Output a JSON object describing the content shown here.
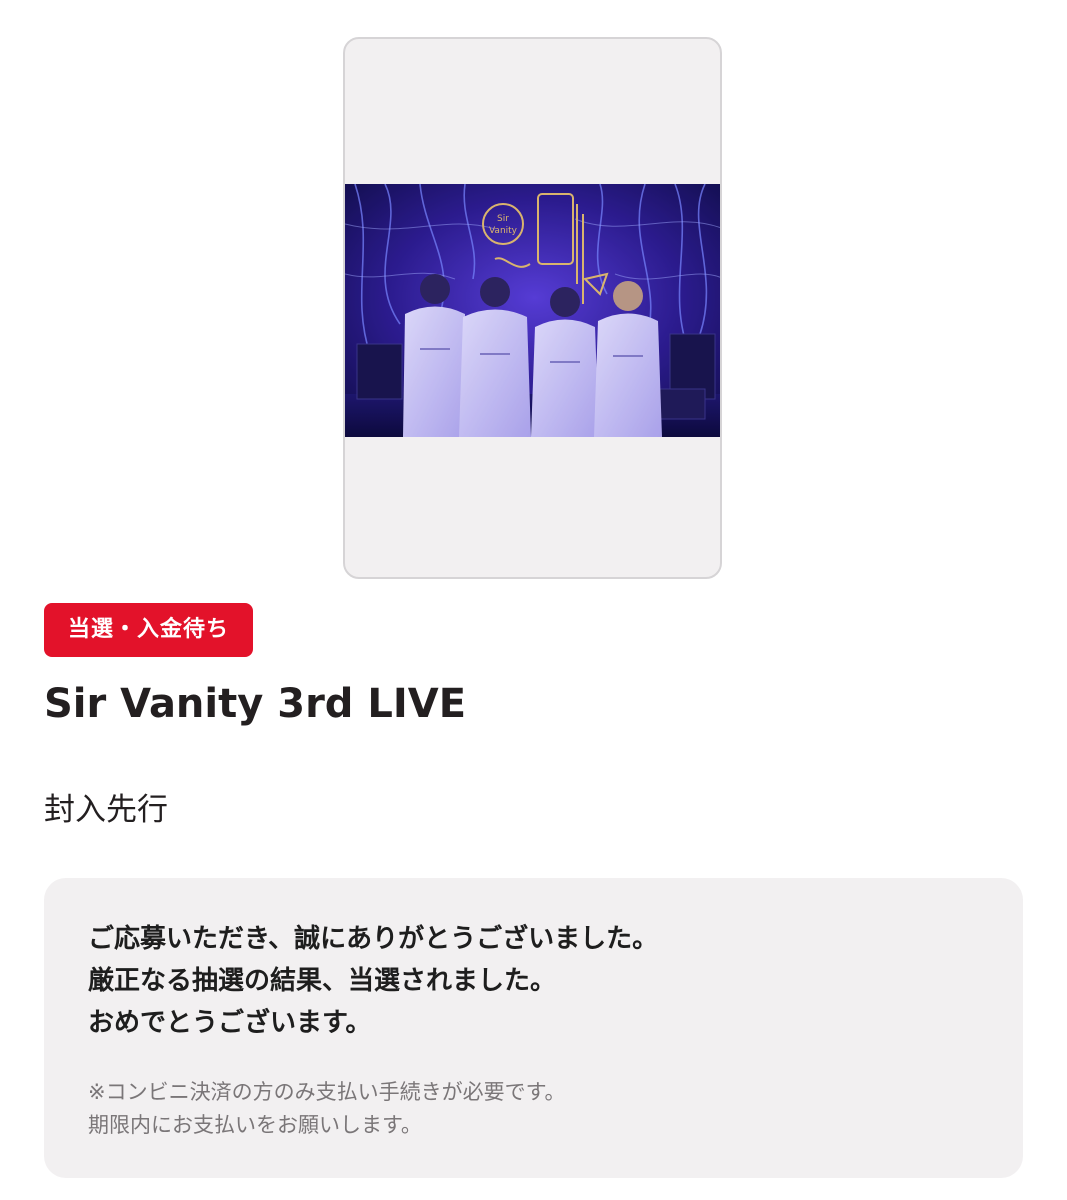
{
  "ticket": {
    "photo_alt": "Sir Vanity",
    "status_badge": "当選・入金待ち",
    "event_title": "Sir Vanity 3rd LIVE",
    "sale_type": "封入先行"
  },
  "result_message": {
    "lines": [
      "ご応募いただき、誠にありがとうございました。",
      "厳正なる抽選の結果、当選されました。",
      "おめでとうございます。"
    ],
    "notes": [
      "※コンビニ決済の方のみ支払い手続きが必要です。",
      "期限内にお支払いをお願いします。"
    ]
  },
  "colors": {
    "badge_red": "#e3122a",
    "card_gray": "#f2f0f1",
    "note_gray": "#7a7678",
    "text_dark": "#231f20"
  }
}
